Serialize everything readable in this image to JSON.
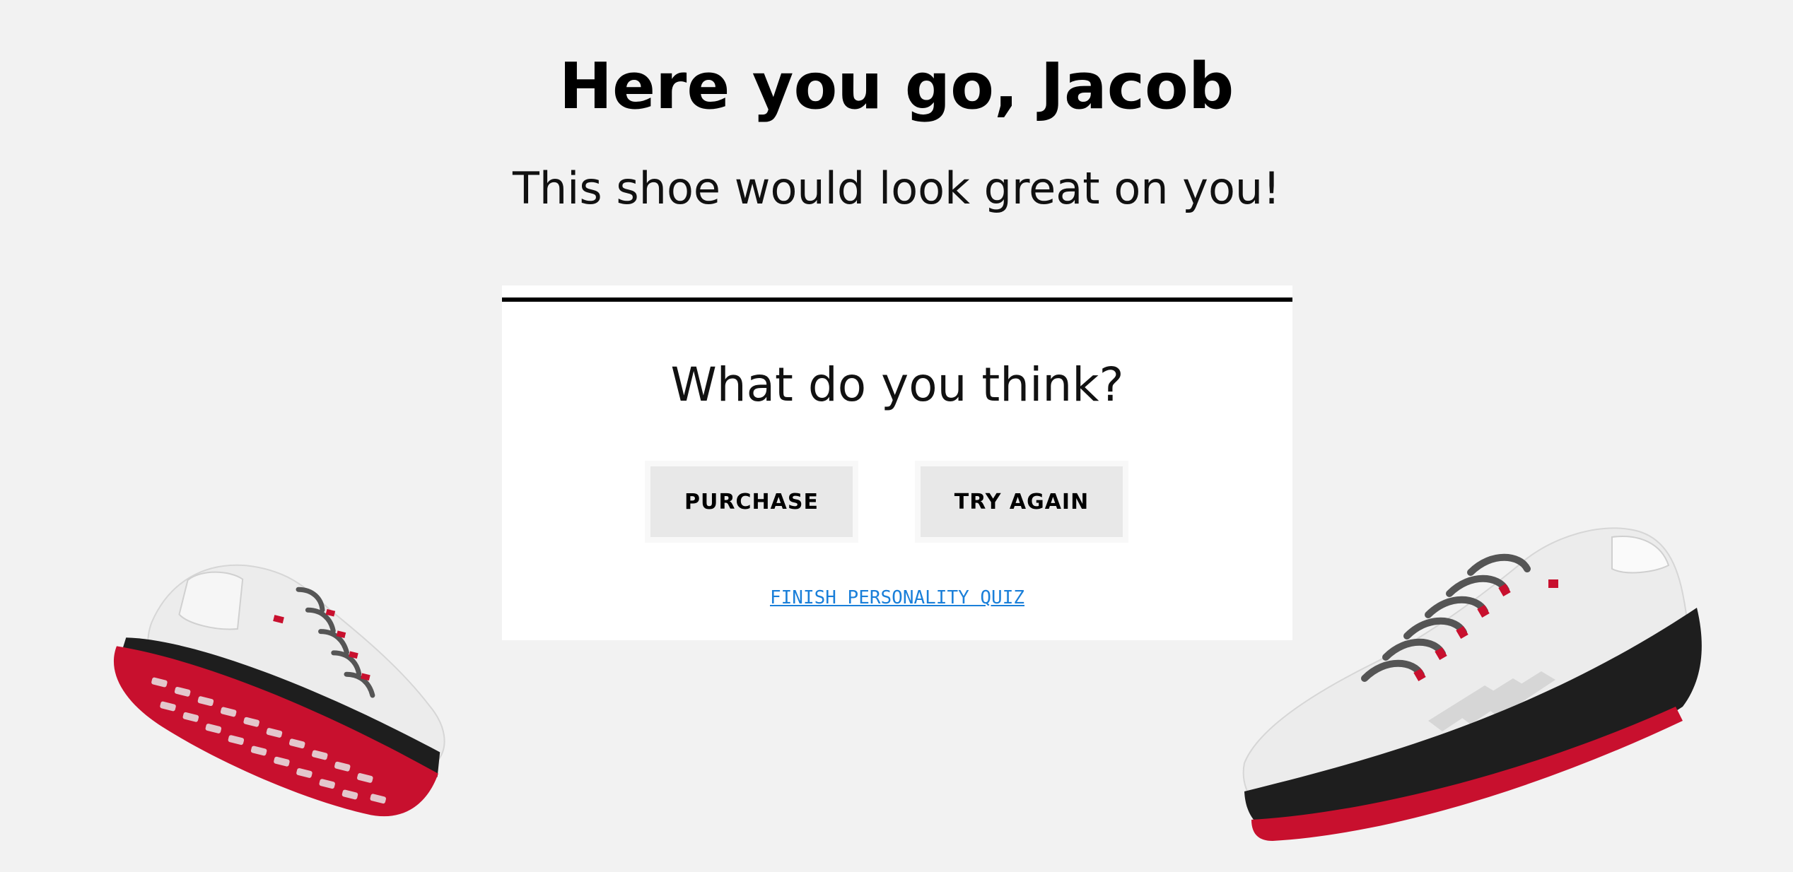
{
  "header": {
    "title": "Here you go, Jacob",
    "subtitle": "This shoe would look great on you!"
  },
  "card": {
    "question": "What do you think?",
    "purchase_label": "PURCHASE",
    "try_again_label": "TRY AGAIN",
    "quiz_link_label": "FINISH PERSONALITY QUIZ"
  },
  "images": {
    "left_shoe": "shoe-sole-view-image",
    "right_shoe": "shoe-side-view-image"
  },
  "colors": {
    "background": "#f2f2f2",
    "card": "#ffffff",
    "button": "#e8e8e8",
    "link": "#1a7fd9",
    "shoe_upper": "#ececec",
    "shoe_sole_red": "#c8102e",
    "shoe_midsole": "#1e1e1e"
  }
}
